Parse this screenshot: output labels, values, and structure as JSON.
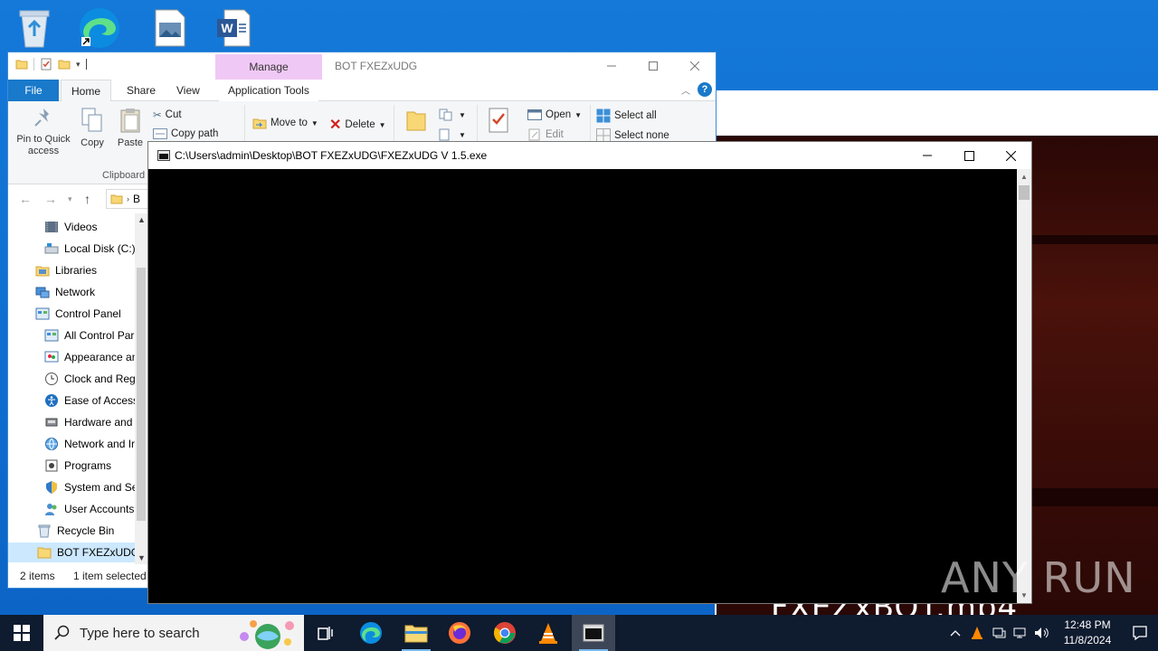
{
  "explorer": {
    "title": "BOT FXEZxUDG",
    "contextual_tab": "Manage",
    "tabs": [
      "File",
      "Home",
      "Share",
      "View",
      "Application Tools"
    ],
    "ribbon": {
      "pin_label": "Pin to Quick access",
      "copy_label": "Copy",
      "paste_label": "Paste",
      "cut_label": "Cut",
      "copy_path_label": "Copy path",
      "clipboard_group": "Clipboard",
      "move_to_label": "Move to",
      "delete_label": "Delete",
      "open_label": "Open",
      "edit_label": "Edit",
      "select_all_label": "Select all",
      "select_none_label": "Select none"
    },
    "address": "B",
    "nav_items": [
      {
        "label": "Videos",
        "icon": "videos-icon"
      },
      {
        "label": "Local Disk (C:)",
        "icon": "drive-icon"
      },
      {
        "label": "Libraries",
        "icon": "libraries-icon"
      },
      {
        "label": "Network",
        "icon": "network-icon"
      },
      {
        "label": "Control Panel",
        "icon": "control-panel-icon"
      },
      {
        "label": "All Control Par",
        "icon": "control-panel-icon"
      },
      {
        "label": "Appearance an",
        "icon": "appearance-icon"
      },
      {
        "label": "Clock and Regi",
        "icon": "clock-icon"
      },
      {
        "label": "Ease of Access",
        "icon": "ease-of-access-icon"
      },
      {
        "label": "Hardware and",
        "icon": "hardware-icon"
      },
      {
        "label": "Network and Ir",
        "icon": "network-internet-icon"
      },
      {
        "label": "Programs",
        "icon": "programs-icon"
      },
      {
        "label": "System and Se",
        "icon": "system-security-icon"
      },
      {
        "label": "User Accounts",
        "icon": "user-accounts-icon"
      },
      {
        "label": "Recycle Bin",
        "icon": "recycle-bin-icon"
      },
      {
        "label": "BOT FXEZxUDG",
        "icon": "folder-icon"
      }
    ],
    "status": {
      "items": "2 items",
      "selected": "1 item selected"
    }
  },
  "console": {
    "title": "C:\\Users\\admin\\Desktop\\BOT FXEZxUDG\\FXEZxUDG V 1.5.exe"
  },
  "media": {
    "caption": "FXEZxBOT.mp4"
  },
  "watermark": "ANY RUN",
  "taskbar": {
    "search_placeholder": "Type here to search",
    "apps": [
      "task-view",
      "edge",
      "file-explorer",
      "firefox",
      "chrome",
      "vlc",
      "console"
    ],
    "time": "12:48 PM",
    "date": "11/8/2024"
  },
  "colors": {
    "accent": "#1979ca",
    "manage_tab": "#f0c8f5",
    "taskbar": "#0f1b2f",
    "desktop": "#0f6cd0"
  }
}
